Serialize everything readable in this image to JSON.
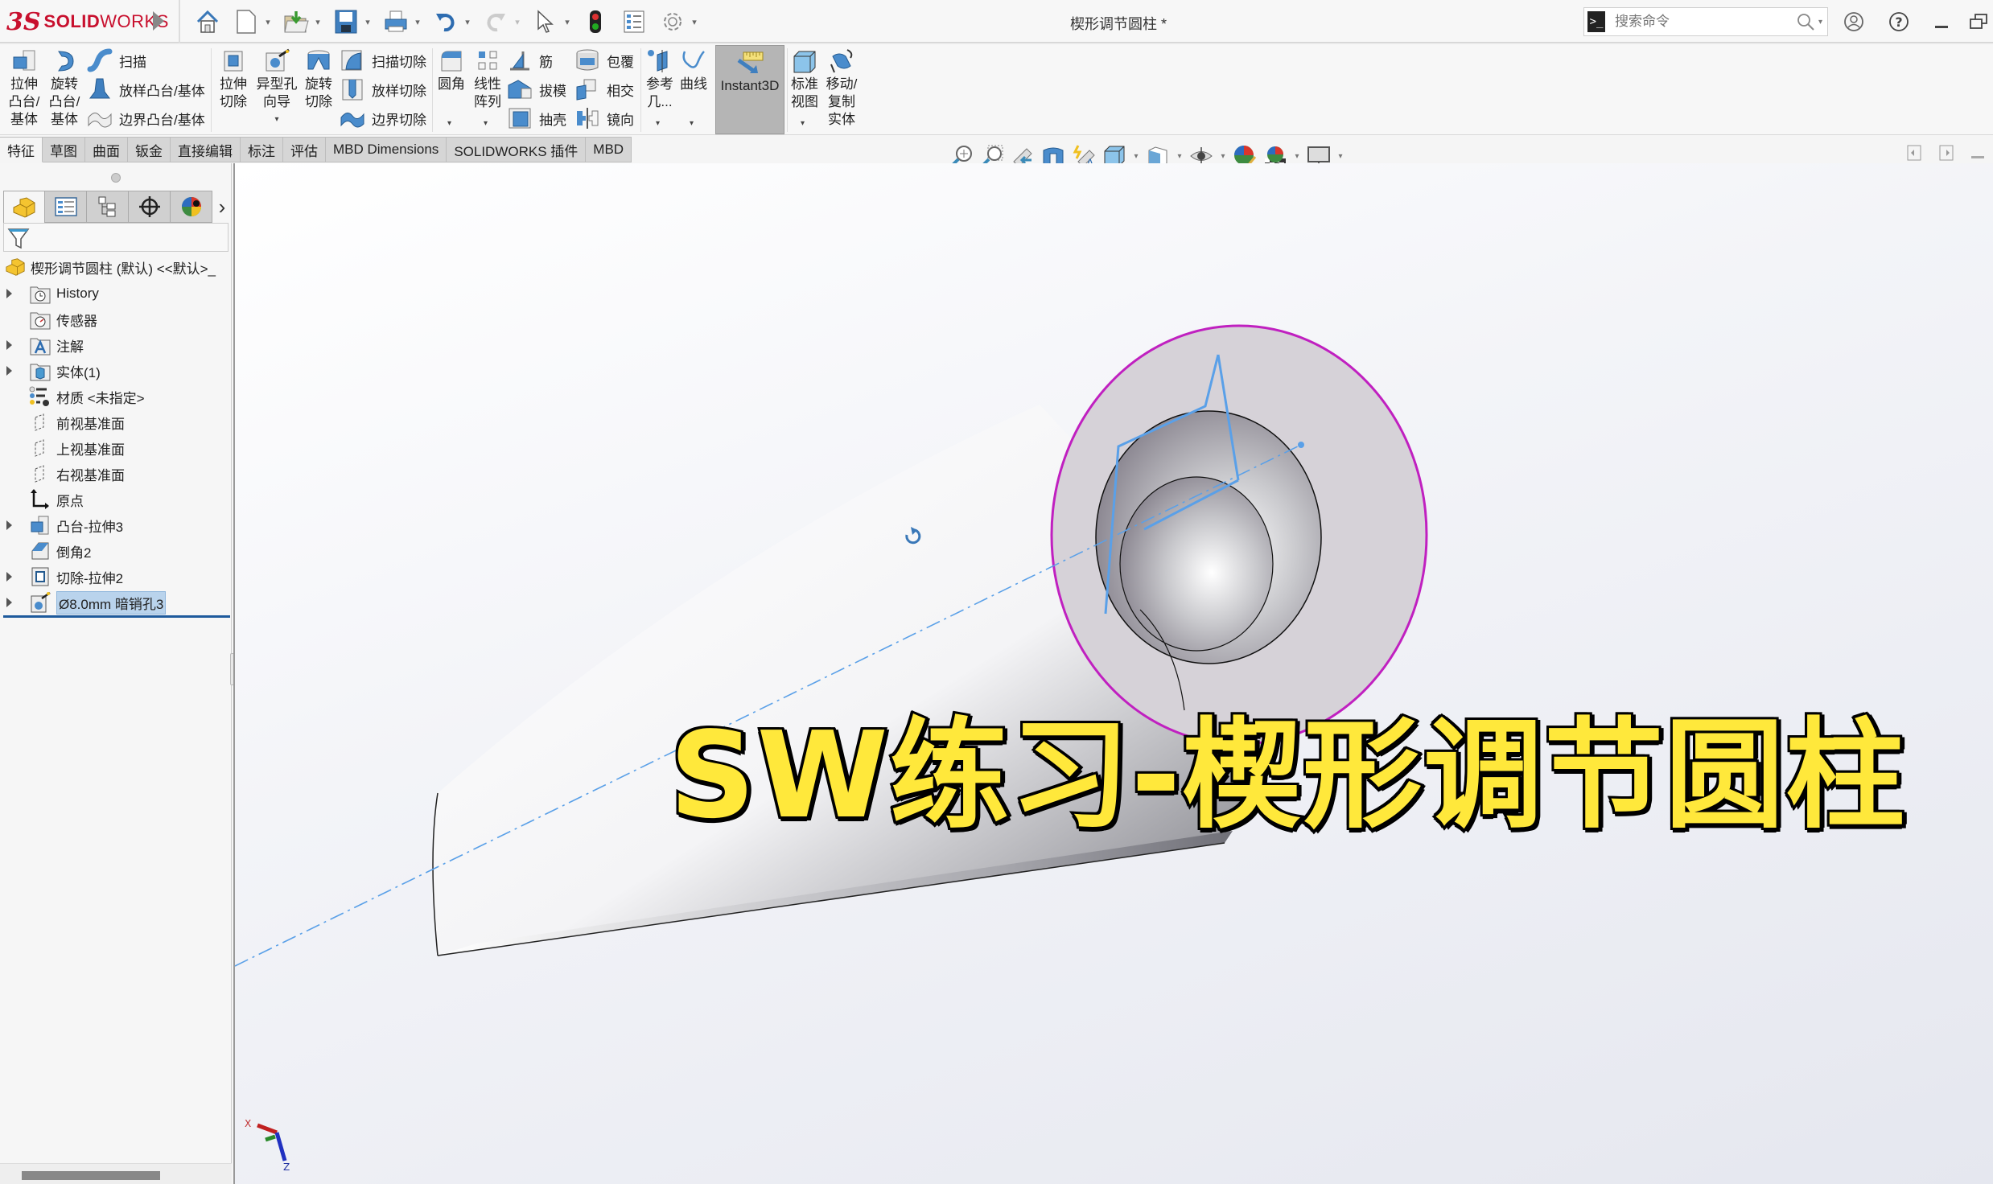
{
  "app": {
    "brand_ds": "3S",
    "brand_solid": "SOLID",
    "brand_works": "WORKS",
    "document_title": "楔形调节圆柱 *"
  },
  "quick_access": [
    {
      "name": "home",
      "icon": "home-icon"
    },
    {
      "name": "new",
      "icon": "new-document-icon",
      "dropdown": true
    },
    {
      "name": "open",
      "icon": "open-folder-icon",
      "dropdown": true
    },
    {
      "name": "save",
      "icon": "save-icon",
      "dropdown": true
    },
    {
      "name": "print",
      "icon": "print-icon",
      "dropdown": true
    },
    {
      "name": "undo",
      "icon": "undo-icon",
      "dropdown": true
    },
    {
      "name": "redo",
      "icon": "redo-icon",
      "dropdown": true,
      "disabled": true
    },
    {
      "name": "select",
      "icon": "cursor-icon",
      "dropdown": true
    },
    {
      "name": "rebuild",
      "icon": "traffic-light-icon"
    },
    {
      "name": "file-properties",
      "icon": "properties-icon"
    },
    {
      "name": "options",
      "icon": "gear-icon",
      "dropdown": true
    }
  ],
  "search": {
    "placeholder": "搜索命令"
  },
  "ribbon": {
    "extrude_boss": "拉伸\n凸台/\n基体",
    "revolve_boss": "旋转\n凸台/\n基体",
    "sweep": "扫描",
    "loft_boss": "放样凸台/基体",
    "boundary_boss": "边界凸台/基体",
    "extrude_cut": "拉伸\n切除",
    "hole_wizard": "异型孔\n向导",
    "revolve_cut": "旋转\n切除",
    "sweep_cut": "扫描切除",
    "loft_cut": "放样切除",
    "boundary_cut": "边界切除",
    "fillet": "圆角",
    "linear_pattern": "线性\n阵列",
    "rib": "筋",
    "draft": "拔模",
    "shell": "抽壳",
    "wrap": "包覆",
    "intersect": "相交",
    "mirror": "镜向",
    "ref_geometry": "参考\n几...",
    "curves": "曲线",
    "instant3d": "Instant3D",
    "standard_views": "标准\n视图",
    "move_copy": "移动/\n复制\n实体"
  },
  "tabs": [
    {
      "label": "特征",
      "active": true
    },
    {
      "label": "草图"
    },
    {
      "label": "曲面"
    },
    {
      "label": "钣金"
    },
    {
      "label": "直接编辑"
    },
    {
      "label": "标注"
    },
    {
      "label": "评估"
    },
    {
      "label": "MBD Dimensions"
    },
    {
      "label": "SOLIDWORKS 插件"
    },
    {
      "label": "MBD"
    }
  ],
  "heads_up": [
    "zoom-to-fit-icon",
    "zoom-to-area-icon",
    "previous-view-icon",
    "section-view-icon",
    "dynamic-annotation-icon",
    "view-orientation-icon",
    "display-style-icon",
    "hide-show-items-icon",
    "edit-appearance-icon",
    "apply-scene-icon",
    "view-settings-icon"
  ],
  "panel_tabs": [
    "featuremanager",
    "propertymanager",
    "configurationmanager",
    "dimxpertmanager",
    "displaymanager"
  ],
  "tree": {
    "root": "楔形调节圆柱 (默认) <<默认>_",
    "items": [
      {
        "label": "History",
        "icon": "history-folder-icon",
        "expandable": true
      },
      {
        "label": "传感器",
        "icon": "sensor-folder-icon",
        "expandable": false
      },
      {
        "label": "注解",
        "icon": "annotation-folder-icon",
        "expandable": true
      },
      {
        "label": "实体(1)",
        "icon": "solid-bodies-folder-icon",
        "expandable": true
      },
      {
        "label": "材质 <未指定>",
        "icon": "material-icon",
        "expandable": false
      },
      {
        "label": "前视基准面",
        "icon": "plane-icon",
        "expandable": false
      },
      {
        "label": "上视基准面",
        "icon": "plane-icon",
        "expandable": false
      },
      {
        "label": "右视基准面",
        "icon": "plane-icon",
        "expandable": false
      },
      {
        "label": "原点",
        "icon": "origin-icon",
        "expandable": false
      },
      {
        "label": "凸台-拉伸3",
        "icon": "boss-extrude-icon",
        "expandable": true
      },
      {
        "label": "倒角2",
        "icon": "chamfer-icon",
        "expandable": false
      },
      {
        "label": "切除-拉伸2",
        "icon": "cut-extrude-icon",
        "expandable": true
      },
      {
        "label": "Ø8.0mm 暗销孔3",
        "icon": "hole-wizard-icon",
        "expandable": true,
        "selected": true
      }
    ]
  },
  "viewport": {
    "overlay_title": "SW练习-楔形调节圆柱",
    "triad": {
      "x": "X",
      "z": "Z"
    }
  },
  "colors": {
    "overlay_fill": "#ffe83b",
    "edge_highlight": "#c020c0",
    "sketch": "#5aa0e8",
    "selection": "#b9d3ec"
  }
}
